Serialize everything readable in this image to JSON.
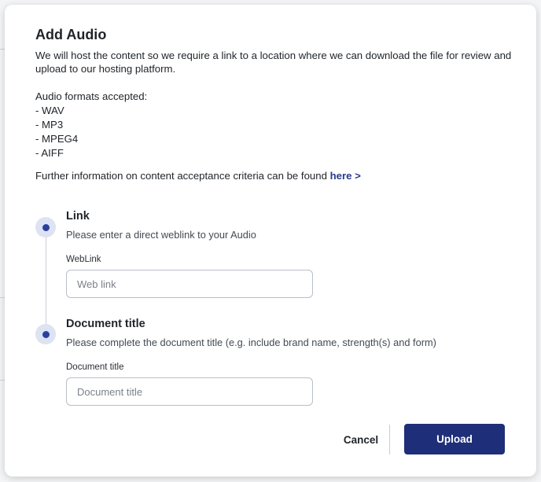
{
  "modal": {
    "title": "Add Audio",
    "intro": "We will host the content so we require a link to a location where we can download the file for review and upload to our hosting platform.",
    "formats_heading": "Audio formats accepted:",
    "formats": [
      "- WAV",
      "- MP3",
      "- MPEG4",
      "- AIFF"
    ],
    "further_text": "Further information on content acceptance criteria can be found ",
    "further_link": "here >"
  },
  "steps": [
    {
      "title": "Link",
      "description": "Please enter a direct weblink to your Audio",
      "field_label": "WebLink",
      "placeholder": "Web link"
    },
    {
      "title": "Document title",
      "description": "Please complete the document title (e.g. include brand name, strength(s) and form)",
      "field_label": "Document title",
      "placeholder": "Document title"
    }
  ],
  "actions": {
    "cancel_label": "Cancel",
    "upload_label": "Upload"
  },
  "colors": {
    "accent": "#1f2e78",
    "link": "#2a3a8c",
    "step_dot": "#2a3fa0"
  }
}
